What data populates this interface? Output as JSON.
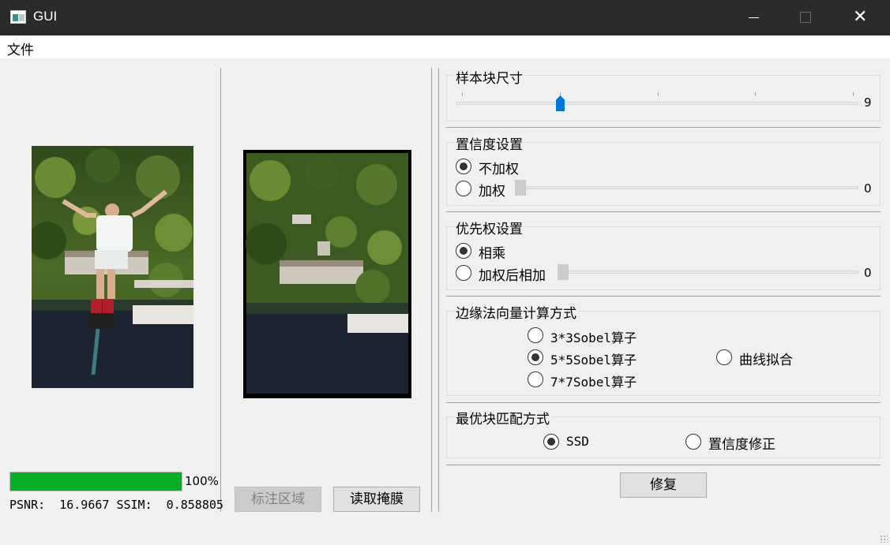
{
  "window": {
    "title": "GUI"
  },
  "menu": {
    "file": "文件"
  },
  "left_panel": {
    "progress_percent": 100,
    "progress_label": "100%",
    "metrics": "PSNR:  16.9667 SSIM:  0.858805"
  },
  "middle_panel": {
    "mark_button": "标注区域",
    "load_mask_button": "读取掩膜"
  },
  "sample_size": {
    "title": "样本块尺寸",
    "value": "9",
    "level": 0.25
  },
  "confidence": {
    "title": "置信度设置",
    "options": [
      "不加权",
      "加权"
    ],
    "selected": 0,
    "weight_value": "0"
  },
  "priority": {
    "title": "优先权设置",
    "options": [
      "相乘",
      "加权后相加"
    ],
    "selected": 0,
    "weight_value": "0"
  },
  "normal_vector": {
    "title": "边缘法向量计算方式",
    "options": [
      "3*3Sobel算子",
      "5*5Sobel算子",
      "7*7Sobel算子",
      "曲线拟合"
    ],
    "selected": 1
  },
  "matching": {
    "title": "最优块匹配方式",
    "options": [
      "SSD",
      "置信度修正"
    ],
    "selected": 0
  },
  "repair_button": "修复",
  "colors": {
    "accent": "#0078d7",
    "progress": "#06b025",
    "titlebar": "#2b2b2b"
  }
}
